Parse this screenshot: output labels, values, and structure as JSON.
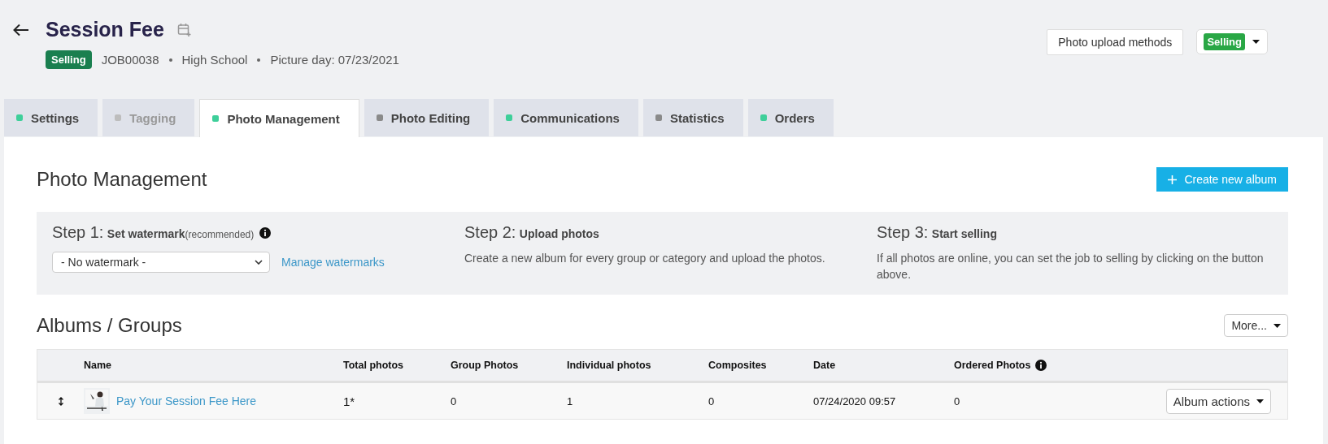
{
  "header": {
    "title": "Session Fee",
    "status_badge": "Selling",
    "job_id": "JOB00038",
    "school": "High School",
    "picture_day": "Picture day: 07/23/2021",
    "upload_button": "Photo upload methods",
    "status_dropdown": "Selling"
  },
  "tabs": [
    {
      "label": "Settings",
      "selected": false,
      "disabled": false,
      "color": "#3ecf9a"
    },
    {
      "label": "Tagging",
      "selected": false,
      "disabled": true,
      "color": "#bdbdbd"
    },
    {
      "label": "Photo Management",
      "selected": true,
      "disabled": false,
      "color": "#3ecf9a"
    },
    {
      "label": "Photo Editing",
      "selected": false,
      "disabled": false,
      "color": "#8a8a8a"
    },
    {
      "label": "Communications",
      "selected": false,
      "disabled": false,
      "color": "#3ecf9a"
    },
    {
      "label": "Statistics",
      "selected": false,
      "disabled": false,
      "color": "#8a8a8a"
    },
    {
      "label": "Orders",
      "selected": false,
      "disabled": false,
      "color": "#3ecf9a"
    }
  ],
  "page_title": "Photo Management",
  "create_button": "Create new album",
  "steps": [
    {
      "step": "Step 1:",
      "title": "Set watermark",
      "note": "(recommended)",
      "kind": "watermark",
      "select_value": "- No watermark -",
      "link": "Manage watermarks"
    },
    {
      "step": "Step 2:",
      "title": "Upload photos",
      "kind": "text",
      "text": "Create a new album for every group or category and upload the photos."
    },
    {
      "step": "Step 3:",
      "title": "Start selling",
      "kind": "text",
      "text": "If all photos are online, you can set the job to selling by clicking on the button above."
    }
  ],
  "albums": {
    "title": "Albums / Groups",
    "more_button": "More...",
    "columns": [
      "Name",
      "Total photos",
      "Group Photos",
      "Individual photos",
      "Composites",
      "Date",
      "Ordered Photos"
    ],
    "rows": [
      {
        "name": "Pay Your Session Fee Here",
        "total": "1*",
        "group": "0",
        "individual": "1",
        "composites": "0",
        "date": "07/24/2020 09:57",
        "ordered": "0",
        "actions": "Album actions"
      }
    ]
  }
}
